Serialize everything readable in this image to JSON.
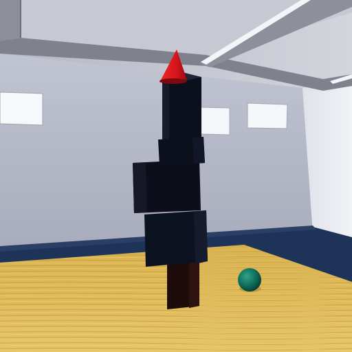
{
  "scene": {
    "objects": [
      {
        "name": "cone",
        "shape": "cone",
        "color": "#d8141c"
      },
      {
        "name": "block-top",
        "shape": "cuboid",
        "color": "#0c0f1c"
      },
      {
        "name": "block-neck",
        "shape": "cuboid",
        "color": "#0c0f1c"
      },
      {
        "name": "block-wide",
        "shape": "cuboid",
        "color": "#0d0e1a"
      },
      {
        "name": "block-low",
        "shape": "cuboid",
        "color": "#0d1220"
      },
      {
        "name": "block-base",
        "shape": "cuboid",
        "color": "#1e0c0a"
      },
      {
        "name": "ball",
        "shape": "sphere",
        "color": "#0e6b58"
      }
    ],
    "room": {
      "wall_color": "#c9ccd8",
      "ceiling_color": "#b9bcc6",
      "floor_color": "#1e3358",
      "table_color": "#d6ad46"
    }
  }
}
